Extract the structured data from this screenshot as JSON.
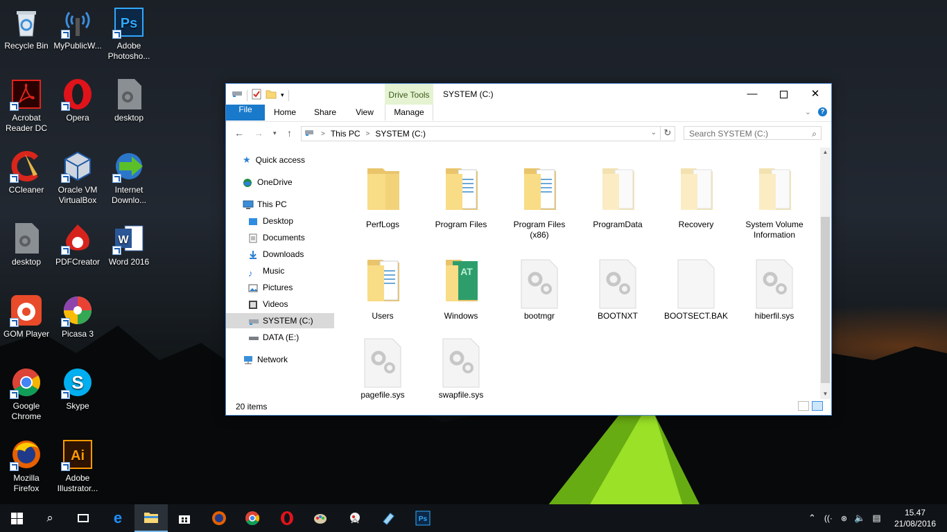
{
  "desktop": {
    "icons": [
      {
        "label": "Recycle Bin",
        "icon": "recycle-bin-icon"
      },
      {
        "label": "MyPublicW...",
        "icon": "wifi-hotspot-icon"
      },
      {
        "label": "Adobe Photosho...",
        "icon": "photoshop-icon"
      },
      {
        "label": "Acrobat Reader DC",
        "icon": "acrobat-icon"
      },
      {
        "label": "Opera",
        "icon": "opera-icon"
      },
      {
        "label": "desktop",
        "icon": "settings-file-icon"
      },
      {
        "label": "CCleaner",
        "icon": "ccleaner-icon"
      },
      {
        "label": "Oracle VM VirtualBox",
        "icon": "virtualbox-icon"
      },
      {
        "label": "Internet Downlo...",
        "icon": "idm-icon"
      },
      {
        "label": "desktop",
        "icon": "settings-file-icon"
      },
      {
        "label": "PDFCreator",
        "icon": "pdfcreator-icon"
      },
      {
        "label": "Word 2016",
        "icon": "word-icon"
      },
      {
        "label": "GOM Player",
        "icon": "gom-player-icon"
      },
      {
        "label": "Picasa 3",
        "icon": "picasa-icon"
      },
      {
        "label": "Google Chrome",
        "icon": "chrome-icon"
      },
      {
        "label": "Skype",
        "icon": "skype-icon"
      },
      {
        "label": "Mozilla Firefox",
        "icon": "firefox-icon"
      },
      {
        "label": "Adobe Illustrator...",
        "icon": "illustrator-icon"
      }
    ]
  },
  "explorer": {
    "title": "SYSTEM (C:)",
    "contextual_tab": "Drive Tools",
    "ribbon_tabs": [
      "File",
      "Home",
      "Share",
      "View",
      "Manage"
    ],
    "address": {
      "segments": [
        "This PC",
        "SYSTEM (C:)"
      ]
    },
    "search_placeholder": "Search SYSTEM (C:)",
    "nav": [
      {
        "label": "Quick access",
        "icon": "star-icon"
      },
      {
        "label": "OneDrive",
        "icon": "onedrive-icon"
      },
      {
        "label": "This PC",
        "icon": "computer-icon"
      },
      {
        "label": "Desktop",
        "icon": "desktop-folder-icon"
      },
      {
        "label": "Documents",
        "icon": "documents-icon"
      },
      {
        "label": "Downloads",
        "icon": "downloads-icon"
      },
      {
        "label": "Music",
        "icon": "music-icon"
      },
      {
        "label": "Pictures",
        "icon": "pictures-icon"
      },
      {
        "label": "Videos",
        "icon": "videos-icon"
      },
      {
        "label": "SYSTEM (C:)",
        "icon": "system-drive-icon"
      },
      {
        "label": "DATA (E:)",
        "icon": "drive-icon"
      },
      {
        "label": "Network",
        "icon": "network-icon"
      }
    ],
    "files": [
      {
        "name": "PerfLogs",
        "kind": "folder"
      },
      {
        "name": "Program Files",
        "kind": "folder-docs"
      },
      {
        "name": "Program Files (x86)",
        "kind": "folder-docs"
      },
      {
        "name": "ProgramData",
        "kind": "folder-hidden"
      },
      {
        "name": "Recovery",
        "kind": "folder-hidden"
      },
      {
        "name": "System Volume Information",
        "kind": "folder-hidden"
      },
      {
        "name": "Users",
        "kind": "folder-docs"
      },
      {
        "name": "Windows",
        "kind": "folder-windows"
      },
      {
        "name": "bootmgr",
        "kind": "system-file"
      },
      {
        "name": "BOOTNXT",
        "kind": "system-file"
      },
      {
        "name": "BOOTSECT.BAK",
        "kind": "blank-file"
      },
      {
        "name": "hiberfil.sys",
        "kind": "system-file"
      },
      {
        "name": "pagefile.sys",
        "kind": "system-file"
      },
      {
        "name": "swapfile.sys",
        "kind": "system-file"
      }
    ],
    "status": "20 items"
  },
  "taskbar": {
    "clock_time": "15.47",
    "clock_date": "21/08/2016"
  }
}
